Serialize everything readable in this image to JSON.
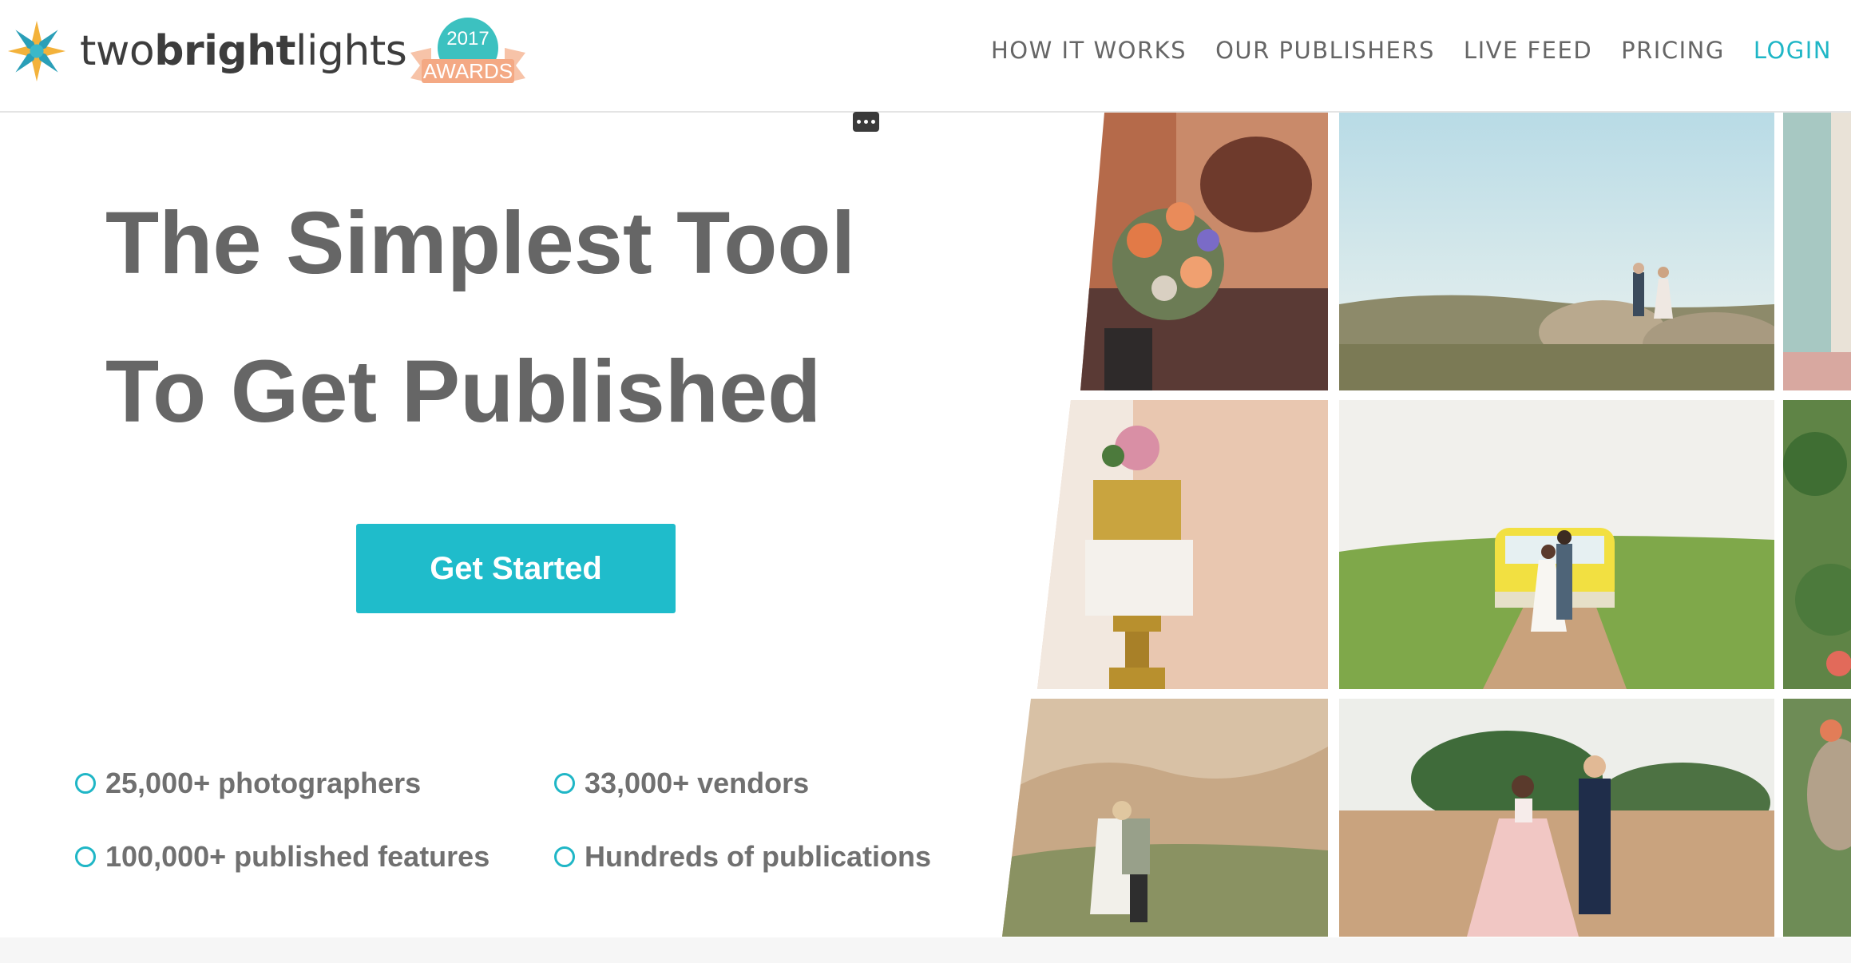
{
  "header": {
    "logo_text_light_1": "two",
    "logo_text_bold": "bright",
    "logo_text_light_2": "lights",
    "award_year": "2017",
    "award_label": "AWARDS",
    "nav": [
      {
        "label": "HOW IT WORKS"
      },
      {
        "label": "OUR PUBLISHERS"
      },
      {
        "label": "LIVE FEED"
      },
      {
        "label": "PRICING"
      },
      {
        "label": "LOGIN"
      }
    ]
  },
  "hero": {
    "headline_line1": "The Simplest Tool",
    "headline_line2": "To Get Published",
    "cta_label": "Get Started"
  },
  "stats": [
    {
      "text": "25,000+ photographers"
    },
    {
      "text": "33,000+ vendors"
    },
    {
      "text": "100,000+ published features"
    },
    {
      "text": "Hundreds of publications"
    }
  ],
  "colors": {
    "accent": "#1fbccb",
    "text": "#666666",
    "award_badge": "#f4a984",
    "award_teal": "#3cc1c0"
  },
  "icons": {
    "logo": "star-burst-icon",
    "menu": "more-dots-icon",
    "stat_bullet": "circle-bullet-icon"
  }
}
